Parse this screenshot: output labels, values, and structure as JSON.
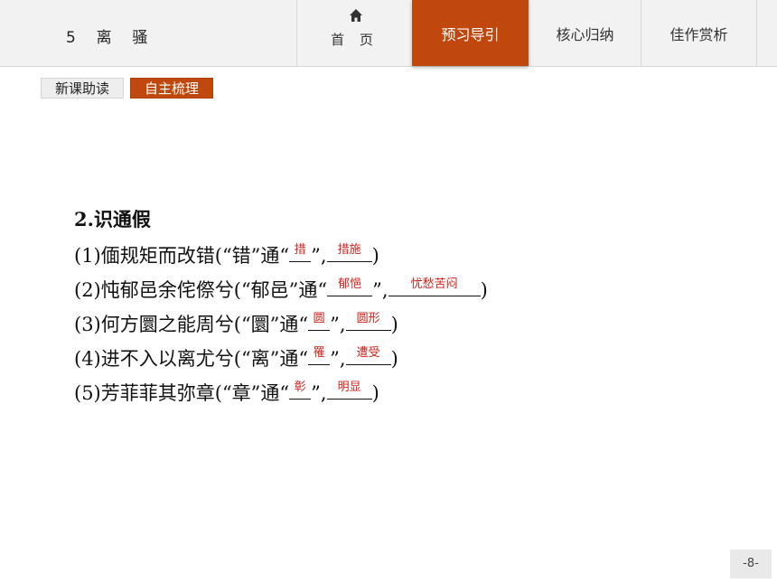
{
  "header": {
    "lesson_title": "5  离  骚",
    "nav": {
      "home": "首 页",
      "preview": "预习导引",
      "summary": "核心归纳",
      "appreciate": "佳作赏析"
    }
  },
  "subtabs": {
    "new_lesson": "新课助读",
    "self_study": "自主梳理"
  },
  "content": {
    "heading_num": "2",
    "heading_text": ".识通假",
    "items": [
      {
        "prefix": "(1)偭规矩而改错(“错”通“",
        "blank1": "措",
        "mid": "”,",
        "blank2": "措施",
        "suffix": ")"
      },
      {
        "prefix": "(2)忳郁邑余侘傺兮(“郁邑”通“",
        "blank1": "郁悒",
        "mid": "”,",
        "blank2": "忧愁苦闷",
        "suffix": ")"
      },
      {
        "prefix": "(3)何方圜之能周兮(“圜”通“",
        "blank1": "圆",
        "mid": "”,",
        "blank2": "圆形",
        "suffix": ")"
      },
      {
        "prefix": "(4)进不入以离尤兮(“离”通“",
        "blank1": "罹",
        "mid": "”,",
        "blank2": "遭受",
        "suffix": ")"
      },
      {
        "prefix": "(5)芳菲菲其弥章(“章”通“",
        "blank1": "彰",
        "mid": "”,",
        "blank2": "明显",
        "suffix": ")"
      }
    ]
  },
  "footer": {
    "page_number": "-8-"
  }
}
